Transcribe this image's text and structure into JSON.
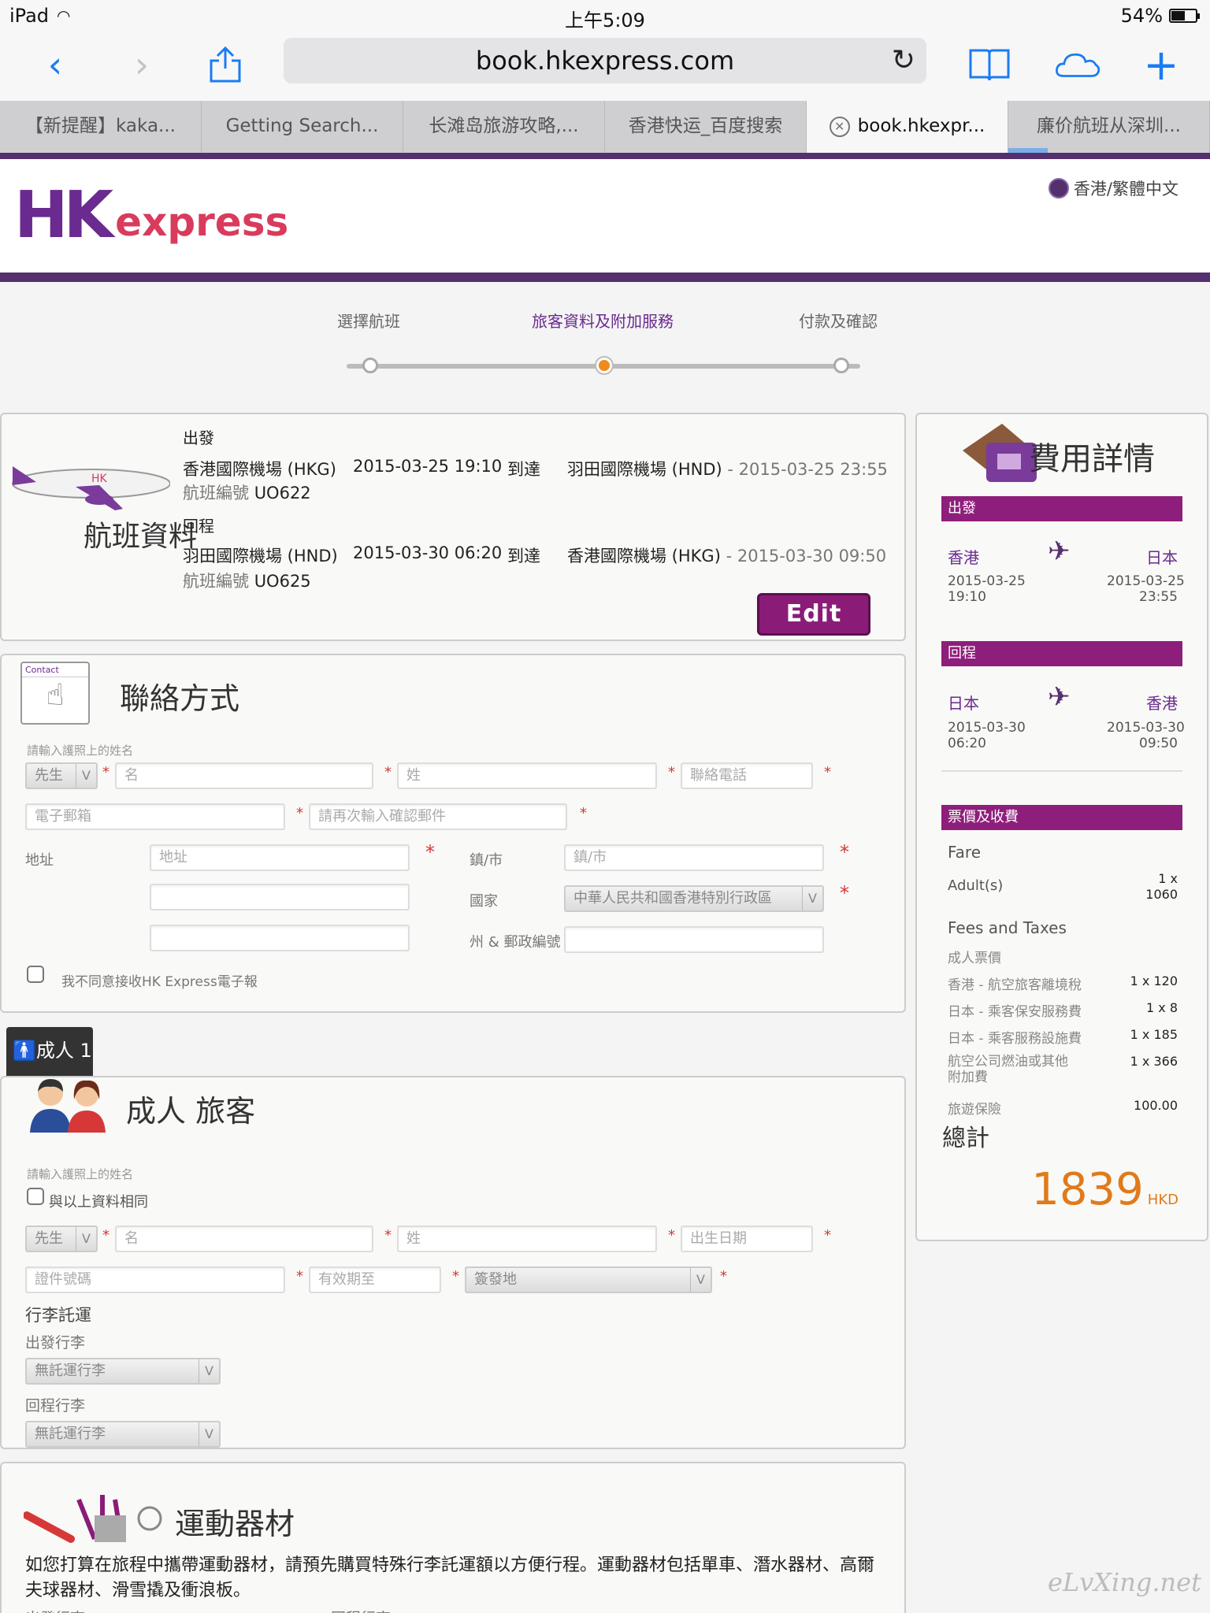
{
  "status": {
    "device": "iPad",
    "time": "上午5:09",
    "battery": "54%",
    "battery_level": 0.54
  },
  "browser": {
    "url": "book.hkexpress.com",
    "tabs": [
      {
        "label": "【新提醒】kaka..."
      },
      {
        "label": "Getting Search..."
      },
      {
        "label": "长滩岛旅游攻略,..."
      },
      {
        "label": "香港快运_百度搜索"
      },
      {
        "label": "book.hkexpr..."
      },
      {
        "label": "廉价航班从深圳..."
      }
    ]
  },
  "site": {
    "logo_hk": "HK",
    "logo_express": "express",
    "language": "香港/繁體中文"
  },
  "steps": {
    "step1": "選擇航班",
    "step2": "旅客資料及附加服務",
    "step3": "付款及確認"
  },
  "flight_info": {
    "title": "航班資料",
    "depart_label": "出發",
    "return_label": "回程",
    "arrive_word": "到達",
    "flight_no_label": "航班編號",
    "outbound": {
      "from": "香港國際機場 (HKG)",
      "dep_time": "2015-03-25 19:10",
      "to": "羽田國際機場 (HND)",
      "arr_time": "- 2015-03-25 23:55",
      "flight_no": "UO622"
    },
    "inbound": {
      "from": "羽田國際機場 (HND)",
      "dep_time": "2015-03-30 06:20",
      "to": "香港國際機場 (HKG)",
      "arr_time": "- 2015-03-30 09:50",
      "flight_no": "UO625"
    },
    "edit_label": "Edit"
  },
  "contact": {
    "icon_label": "Contact",
    "title": "聯絡方式",
    "hint": "請輸入護照上的姓名",
    "salutation": "先生",
    "first_name_ph": "名",
    "last_name_ph": "姓",
    "phone_ph": "聯絡電話",
    "email_ph": "電子郵箱",
    "email_confirm_ph": "請再次輸入確認郵件",
    "address_label": "地址",
    "address_ph": "地址",
    "city_label": "鎮/市",
    "city_ph": "鎮/市",
    "country_label": "國家",
    "country_value": "中華人民共和國香港特別行政區",
    "zip_label": "州 & 郵政編號",
    "newsletter": "我不同意接收HK Express電子報"
  },
  "passenger": {
    "tab_label": "成人 1",
    "title": "成人 旅客",
    "hint": "請輸入護照上的姓名",
    "same_as_above": "與以上資料相同",
    "salutation": "先生",
    "first_name_ph": "名",
    "last_name_ph": "姓",
    "dob_ph": "出生日期",
    "id_ph": "證件號碼",
    "expiry_ph": "有效期至",
    "issue_place": "簽發地",
    "baggage_title": "行李託運",
    "dep_baggage_label": "出發行李",
    "dep_baggage_value": "無託運行李",
    "ret_baggage_label": "回程行李",
    "ret_baggage_value": "無託運行李"
  },
  "sports": {
    "title": "運動器材",
    "description": "如您打算在旅程中攜帶運動器材，請預先購買特殊行李託運額以方便行程。運動器材包括單車、潛水器材、高爾夫球器材、滑雪撬及衝浪板。",
    "dep_label": "出發行李",
    "ret_label": "回程行李"
  },
  "fees": {
    "title": "費用詳情",
    "depart_header": "出發",
    "return_header": "回程",
    "out_from": "香港",
    "out_to": "日本",
    "out_dep_date": "2015-03-25",
    "out_dep_time": "19:10",
    "out_arr_date": "2015-03-25",
    "out_arr_time": "23:55",
    "ret_from": "日本",
    "ret_to": "香港",
    "ret_dep_date": "2015-03-30",
    "ret_dep_time": "06:20",
    "ret_arr_date": "2015-03-30",
    "ret_arr_time": "09:50",
    "fare_header": "票價及收費",
    "fare_label": "Fare",
    "adult_label": "Adult(s)",
    "adult_qty": "1 x",
    "adult_price": "1060",
    "fees_label": "Fees and Taxes",
    "adult_fare_label": "成人票價",
    "items": [
      {
        "name": "香港 - 航空旅客離境稅",
        "value": "1 x 120"
      },
      {
        "name": "日本 - 乘客保安服務費",
        "value": "1 x 8"
      },
      {
        "name": "日本 - 乘客服務設施費",
        "value": "1 x 185"
      },
      {
        "name": "航空公司燃油或其他附加費",
        "value": "1 x 366"
      },
      {
        "name": "旅遊保險",
        "value": "100.00"
      }
    ],
    "total_label": "總計",
    "total": "1839",
    "currency": "HKD"
  },
  "watermark": "eLvXing.net"
}
